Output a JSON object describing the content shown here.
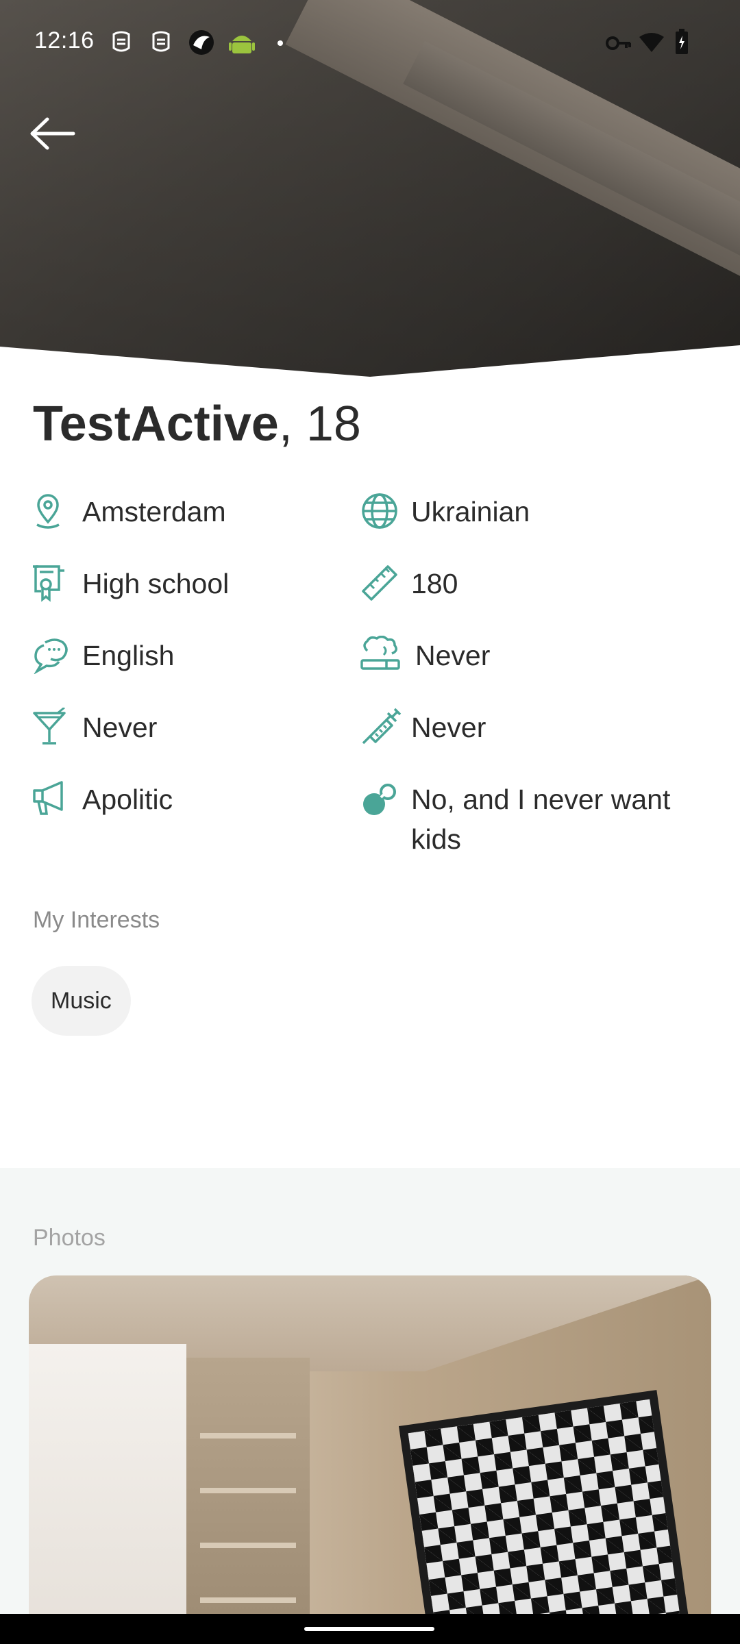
{
  "status_bar": {
    "time": "12:16"
  },
  "profile": {
    "name": "TestActive",
    "age_suffix": ", 18",
    "details": {
      "location": "Amsterdam",
      "nationality": "Ukrainian",
      "education": "High school",
      "height": "180",
      "language": "English",
      "smoking": "Never",
      "drinking": "Never",
      "drugs": "Never",
      "politics": "Apolitic",
      "kids": "No, and I never want kids"
    }
  },
  "interests": {
    "label": "My Interests",
    "items": [
      "Music"
    ]
  },
  "photos": {
    "label": "Photos"
  },
  "colors": {
    "accent_icon": "#4aa597",
    "chip_bg": "#f2f2f2",
    "section_label": "#8a8a8a",
    "photos_bg": "#f4f7f6"
  },
  "icons": {
    "back": "arrow-left-icon",
    "location": "location-pin-icon",
    "nationality": "globe-icon",
    "education": "diploma-icon",
    "height": "ruler-icon",
    "language": "chat-bubbles-icon",
    "smoking": "cigarette-icon",
    "drinking": "cocktail-icon",
    "drugs": "syringe-icon",
    "politics": "megaphone-icon",
    "kids": "pacifier-icon"
  }
}
